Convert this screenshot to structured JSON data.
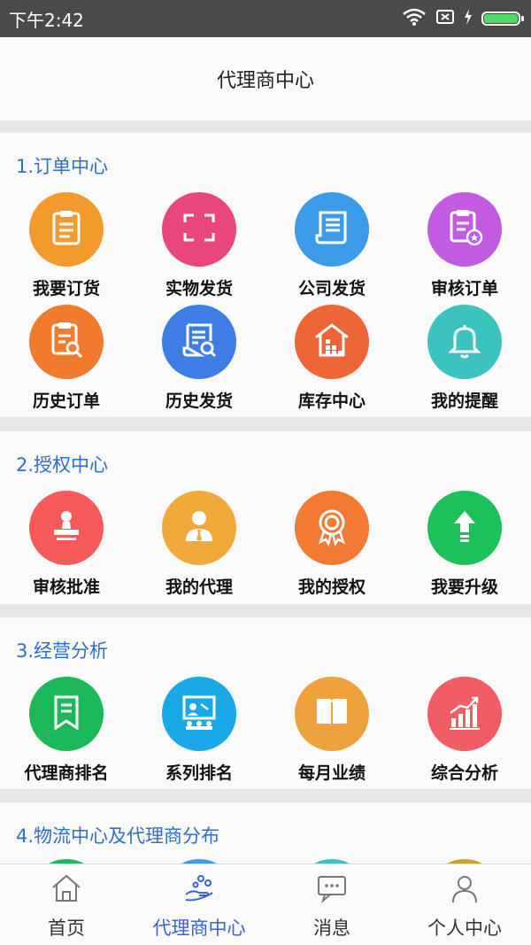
{
  "status_bar": {
    "time": "下午2:42"
  },
  "header": {
    "title": "代理商中心"
  },
  "sections": [
    {
      "title": "1.订单中心",
      "items": [
        {
          "label": "我要订货",
          "color": "#f39a2c",
          "icon": "clipboard-icon"
        },
        {
          "label": "实物发货",
          "color": "#e8467c",
          "icon": "scan-frame-icon"
        },
        {
          "label": "公司发货",
          "color": "#3b9be8",
          "icon": "scroll-list-icon"
        },
        {
          "label": "审核订单",
          "color": "#c15ce0",
          "icon": "clipboard-badge-icon"
        },
        {
          "label": "历史订单",
          "color": "#f07b2c",
          "icon": "clipboard-search-icon"
        },
        {
          "label": "历史发货",
          "color": "#3c7ee6",
          "icon": "scroll-search-icon"
        },
        {
          "label": "库存中心",
          "color": "#ee6638",
          "icon": "warehouse-icon"
        },
        {
          "label": "我的提醒",
          "color": "#3cc3c0",
          "icon": "bell-icon"
        }
      ]
    },
    {
      "title": "2.授权中心",
      "items": [
        {
          "label": "审核批准",
          "color": "#f75a5a",
          "icon": "stamp-icon"
        },
        {
          "label": "我的代理",
          "color": "#f2a93c",
          "icon": "person-tie-icon"
        },
        {
          "label": "我的授权",
          "color": "#f37a33",
          "icon": "award-badge-icon"
        },
        {
          "label": "我要升级",
          "color": "#1cc259",
          "icon": "upgrade-arrow-icon"
        }
      ]
    },
    {
      "title": "3.经营分析",
      "items": [
        {
          "label": "代理商排名",
          "color": "#1cb85a",
          "icon": "bookmark-list-icon"
        },
        {
          "label": "系列排名",
          "color": "#1aa9e8",
          "icon": "presentation-icon"
        },
        {
          "label": "每月业绩",
          "color": "#eea23e",
          "icon": "open-book-icon"
        },
        {
          "label": "综合分析",
          "color": "#f25c64",
          "icon": "bar-chart-rise-icon"
        }
      ]
    },
    {
      "title": "4.物流中心及代理商分布",
      "items": [
        {
          "color": "#1cb85a"
        },
        {
          "color": "#3b9be8"
        },
        {
          "color": "#3cc3c0"
        },
        {
          "color": "#c9a12a"
        }
      ]
    }
  ],
  "tabbar": [
    {
      "label": "首页",
      "icon": "home-icon",
      "active": false
    },
    {
      "label": "代理商中心",
      "icon": "agent-hand-icon",
      "active": true
    },
    {
      "label": "消息",
      "icon": "message-icon",
      "active": false
    },
    {
      "label": "个人中心",
      "icon": "user-icon",
      "active": false
    }
  ],
  "colors": {
    "accent": "#2e6fc7",
    "tab_active": "#3a62d6"
  }
}
